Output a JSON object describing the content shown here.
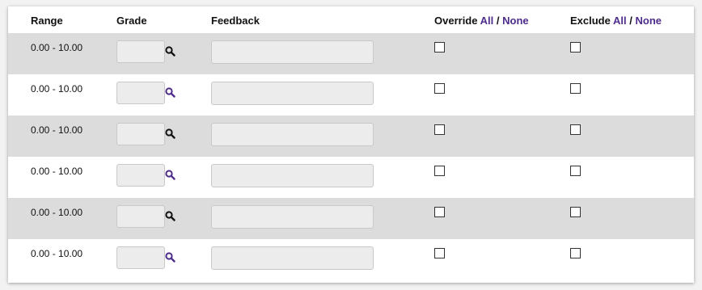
{
  "header": {
    "range": "Range",
    "grade": "Grade",
    "feedback": "Feedback",
    "override": "Override",
    "exclude": "Exclude",
    "all": "All",
    "separator": "/",
    "none": "None"
  },
  "colors": {
    "link": "#4d2c8c",
    "shaded_row": "#dcdcdc"
  },
  "rows": [
    {
      "range": "0.00 - 10.00",
      "grade": "",
      "feedback": "",
      "override": false,
      "exclude": false,
      "search_icon_color": "#111111"
    },
    {
      "range": "0.00 - 10.00",
      "grade": "",
      "feedback": "",
      "override": false,
      "exclude": false,
      "search_icon_color": "#4d2c8c"
    },
    {
      "range": "0.00 - 10.00",
      "grade": "",
      "feedback": "",
      "override": false,
      "exclude": false,
      "search_icon_color": "#111111"
    },
    {
      "range": "0.00 - 10.00",
      "grade": "",
      "feedback": "",
      "override": false,
      "exclude": false,
      "search_icon_color": "#4d2c8c"
    },
    {
      "range": "0.00 - 10.00",
      "grade": "",
      "feedback": "",
      "override": false,
      "exclude": false,
      "search_icon_color": "#111111"
    },
    {
      "range": "0.00 - 10.00",
      "grade": "",
      "feedback": "",
      "override": false,
      "exclude": false,
      "search_icon_color": "#4d2c8c"
    }
  ]
}
